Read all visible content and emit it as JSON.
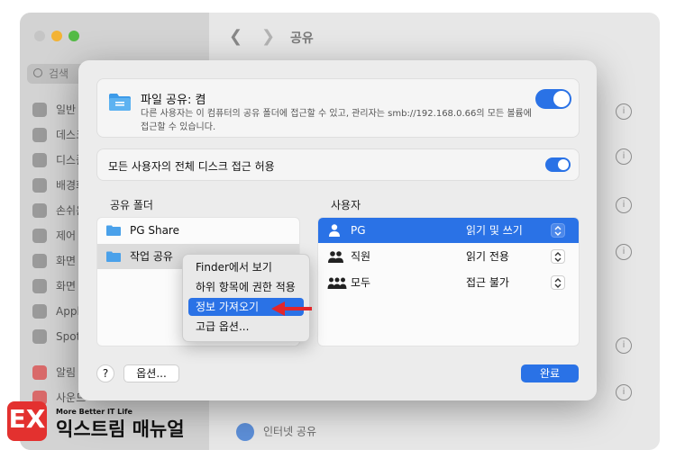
{
  "window": {
    "title": "공유",
    "sidebar": {
      "search_placeholder": "검색",
      "items": [
        {
          "label": "일반"
        },
        {
          "label": "데스크"
        },
        {
          "label": "디스플"
        },
        {
          "label": "배경화"
        },
        {
          "label": "손쉬운"
        },
        {
          "label": "제어 "
        },
        {
          "label": "화면 "
        },
        {
          "label": "화면 "
        },
        {
          "label": "Apple"
        },
        {
          "label": "Spot"
        },
        {
          "label": "알림"
        },
        {
          "label": "사운드"
        }
      ]
    },
    "background_rows": [
      {
        "label": "인터넷 공유"
      }
    ]
  },
  "dialog": {
    "file_sharing": {
      "title": "파일 공유: 켬",
      "description": "다른 사용자는 이 컴퓨터의 공유 폴더에 접근할 수 있고, 관리자는 smb://192.168.0.66의 모든 볼륨에 접근할 수 있습니다.",
      "enabled": true
    },
    "full_disk": {
      "label": "모든 사용자의 전체 디스크 접근 허용",
      "enabled": true
    },
    "shared_folders": {
      "header": "공유 폴더",
      "items": [
        {
          "name": "PG Share",
          "selected": false
        },
        {
          "name": "작업 공유",
          "selected": true
        }
      ]
    },
    "users": {
      "header": "사용자",
      "items": [
        {
          "name": "PG",
          "permission": "읽기 및 쓰기",
          "icon": "single-user-icon",
          "selected": true
        },
        {
          "name": "직원",
          "permission": "읽기 전용",
          "icon": "group-icon",
          "selected": false
        },
        {
          "name": "모두",
          "permission": "접근 불가",
          "icon": "everyone-icon",
          "selected": false
        }
      ]
    },
    "buttons": {
      "help": "?",
      "options": "옵션...",
      "done": "완료"
    }
  },
  "context_menu": {
    "items": [
      {
        "label": "Finder에서 보기",
        "highlighted": false
      },
      {
        "label": "하위 항목에 권한 적용",
        "highlighted": false
      },
      {
        "label": "정보 가져오기",
        "highlighted": true
      },
      {
        "label": "고급 옵션...",
        "highlighted": false
      }
    ]
  },
  "watermark": {
    "logo_letter": "EX",
    "tagline": "More Better IT Life",
    "brand": "익스트림 매뉴얼"
  },
  "colors": {
    "accent": "#2a72e6",
    "annotation_arrow": "#e3262a",
    "logo_red": "#e3312f"
  }
}
